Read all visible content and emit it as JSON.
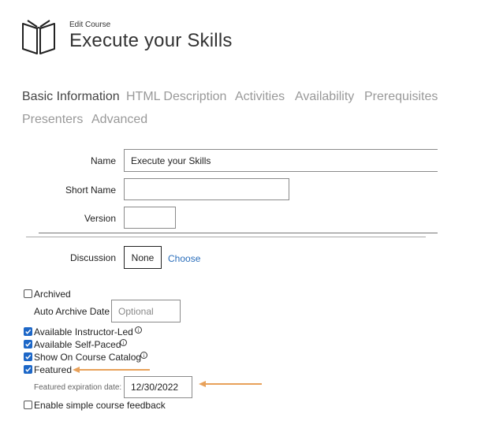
{
  "header": {
    "subtitle": "Edit Course",
    "title": "Execute your Skills"
  },
  "tabs": [
    {
      "label": "Basic Information",
      "active": true
    },
    {
      "label": "HTML Description",
      "active": false
    },
    {
      "label": "Activities",
      "active": false
    },
    {
      "label": "Availability",
      "active": false
    },
    {
      "label": "Prerequisites",
      "active": false
    },
    {
      "label": "Presenters",
      "active": false
    },
    {
      "label": "Advanced",
      "active": false
    }
  ],
  "form": {
    "name_label": "Name",
    "name_value": "Execute your Skills",
    "short_name_label": "Short Name",
    "short_name_value": "",
    "version_label": "Version",
    "version_value": "",
    "discussion_label": "Discussion",
    "discussion_value": "None",
    "choose_link": "Choose"
  },
  "options": {
    "archived": {
      "label": "Archived",
      "checked": false
    },
    "auto_archive_label": "Auto Archive Date",
    "auto_archive_placeholder": "Optional",
    "instructor_led": {
      "label": "Available Instructor-Led",
      "checked": true
    },
    "self_paced": {
      "label": "Available Self-Paced",
      "checked": true
    },
    "show_catalog": {
      "label": "Show On Course Catalog",
      "checked": true
    },
    "featured": {
      "label": "Featured",
      "checked": true
    },
    "featured_expiration_label": "Featured expiration date:",
    "featured_expiration_value": "12/30/2022",
    "simple_feedback": {
      "label": "Enable simple course feedback",
      "checked": false
    }
  },
  "annotation_color": "#e8a15a",
  "accent_color": "#1d67c7",
  "link_color": "#2a6ebb"
}
